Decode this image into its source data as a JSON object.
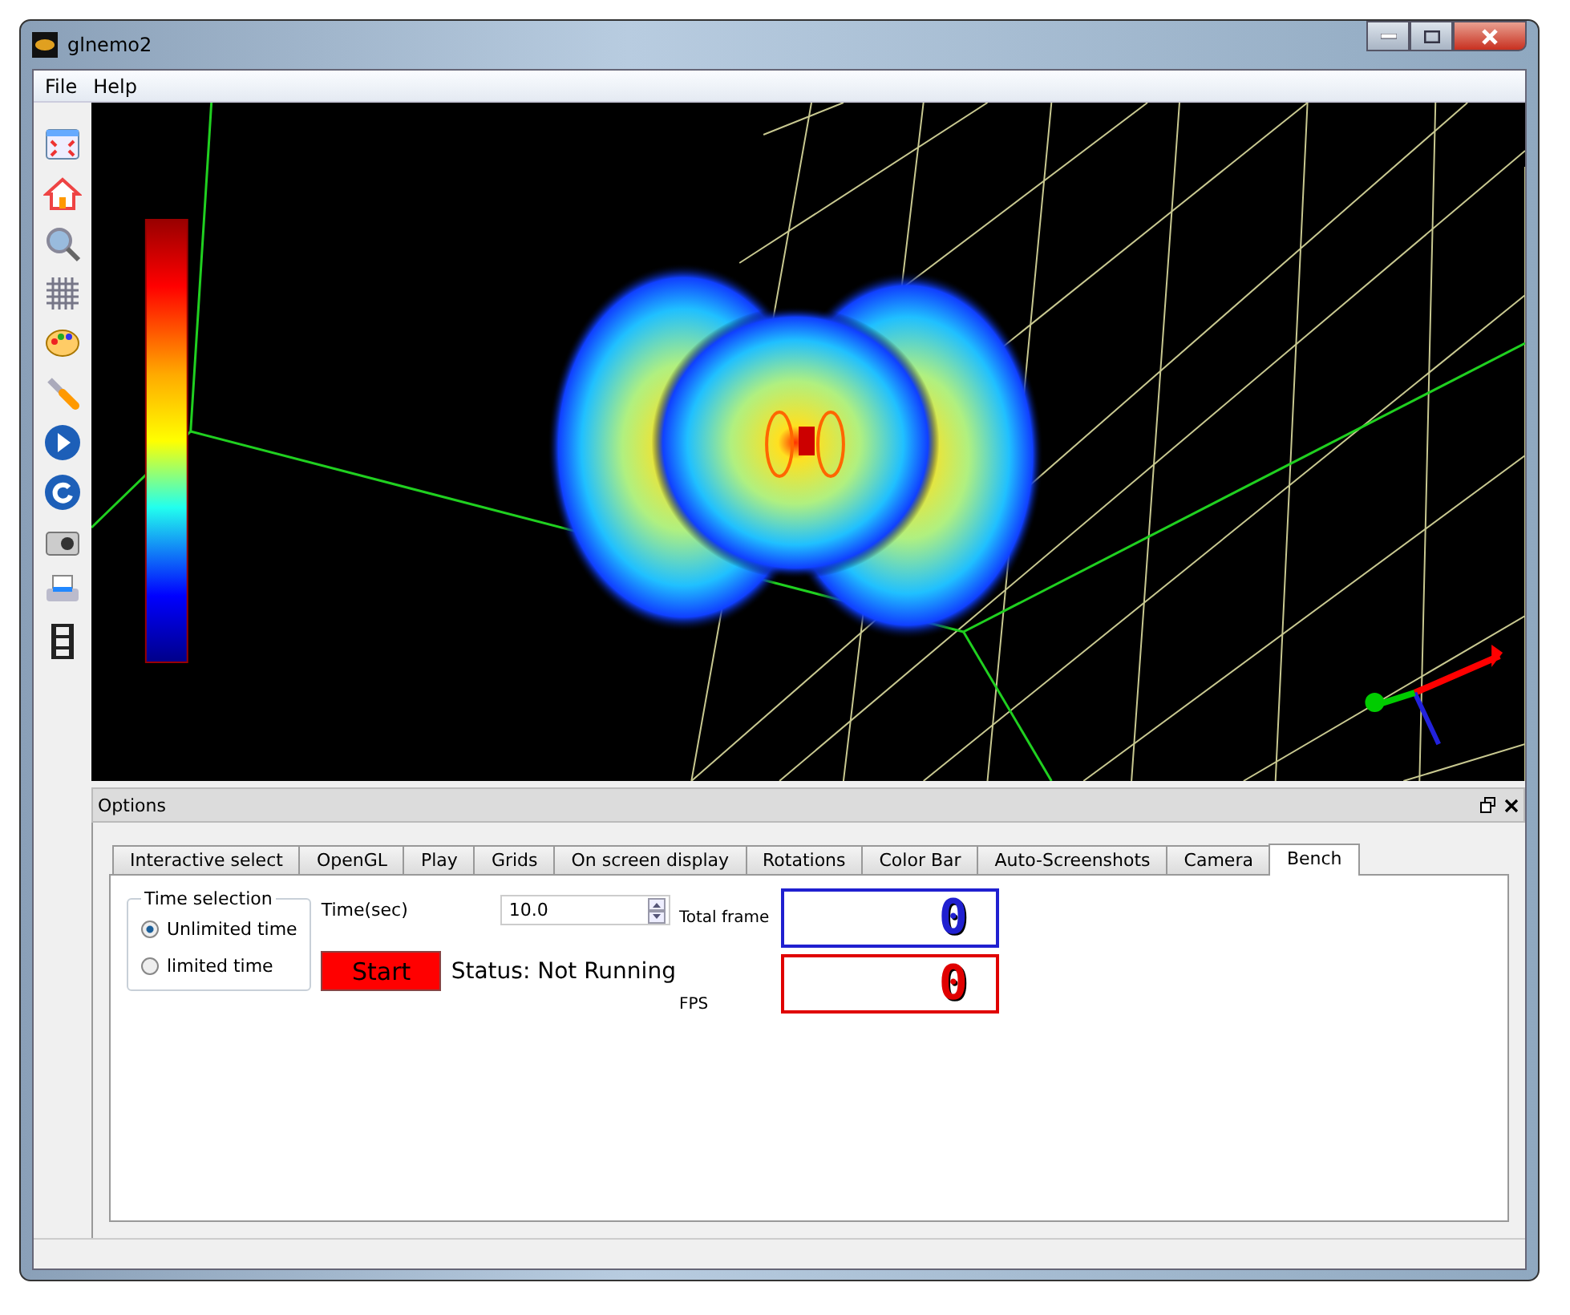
{
  "window": {
    "title": "glnemo2"
  },
  "menu": [
    "File",
    "Help"
  ],
  "options": {
    "title": "Options",
    "tabs": [
      {
        "label": "Interactive select",
        "selected": false
      },
      {
        "label": "OpenGL",
        "selected": false
      },
      {
        "label": "Play",
        "selected": false
      },
      {
        "label": "Grids",
        "selected": false
      },
      {
        "label": "On screen display",
        "selected": false
      },
      {
        "label": "Rotations",
        "selected": false
      },
      {
        "label": "Color Bar",
        "selected": false
      },
      {
        "label": "Auto-Screenshots",
        "selected": false
      },
      {
        "label": "Camera",
        "selected": false
      },
      {
        "label": "Bench",
        "selected": true
      }
    ],
    "time_selection": {
      "title": "Time selection",
      "options": [
        {
          "label": "Unlimited time",
          "selected": true
        },
        {
          "label": "limited time",
          "selected": false
        }
      ]
    },
    "time": {
      "label": "Time(sec)",
      "value": "10.0"
    },
    "start_button": "Start",
    "status": "Status:  Not Running",
    "displays": [
      {
        "label": "Total frame",
        "value": "0",
        "color": "#2020d0"
      },
      {
        "label": "FPS",
        "value": "0",
        "color": "#e00000"
      }
    ]
  }
}
